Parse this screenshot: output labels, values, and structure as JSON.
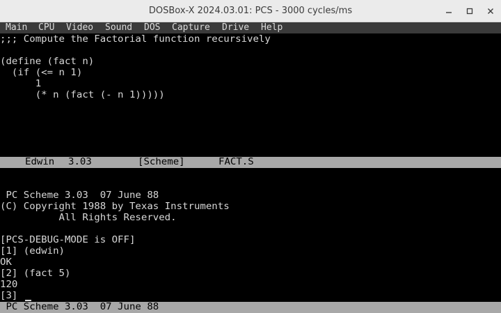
{
  "window": {
    "title": "DOSBox-X 2024.03.01: PCS - 3000 cycles/ms"
  },
  "menu": {
    "items": [
      "Main",
      "CPU",
      "Video",
      "Sound",
      "DOS",
      "Capture",
      "Drive",
      "Help"
    ]
  },
  "editor": {
    "lines": [
      ";;; Compute the Factorial function recursively",
      "",
      "(define (fact n)",
      "  (if (<= n 1)",
      "      1",
      "      (* n (fact (- n 1)))))"
    ]
  },
  "editor_status": {
    "name": "Edwin",
    "version": "3.03",
    "mode": "[Scheme]",
    "file": "FACT.S"
  },
  "repl": {
    "lines": [
      " PC Scheme 3.03  07 June 88",
      "(C) Copyright 1988 by Texas Instruments",
      "          All Rights Reserved.",
      "",
      "[PCS-DEBUG-MODE is OFF]",
      "[1] (edwin)",
      "OK",
      "[2] (fact 5)",
      "120",
      "[3] "
    ]
  },
  "bottom_status": {
    "text": " PC Scheme 3.03  07 June 88"
  },
  "colors": {
    "titlebar": "#ebebeb",
    "menubar": "#3a3a3a",
    "screen": "#000000",
    "text": "#d8d8d8",
    "statusbar": "#a8a8a8"
  }
}
